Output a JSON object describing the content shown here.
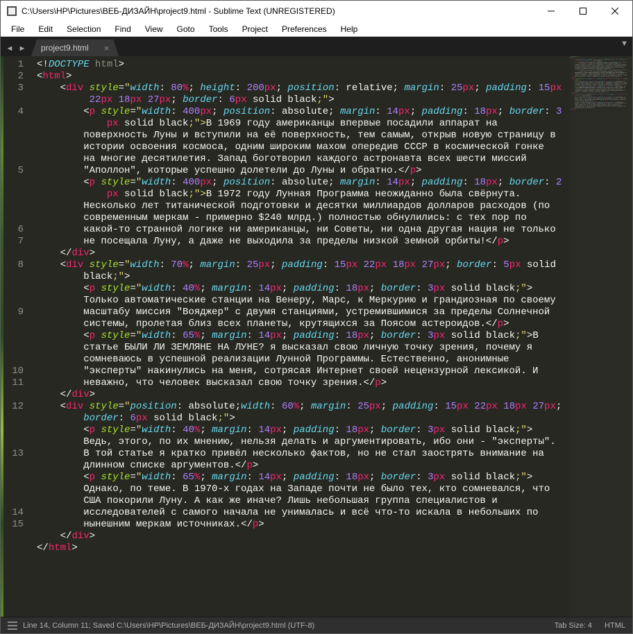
{
  "window": {
    "title": "C:\\Users\\HP\\Pictures\\ВЕБ-ДИЗАЙН\\project9.html - Sublime Text (UNREGISTERED)"
  },
  "menu": {
    "file": "File",
    "edit": "Edit",
    "selection": "Selection",
    "find": "Find",
    "view": "View",
    "goto": "Goto",
    "tools": "Tools",
    "project": "Project",
    "preferences": "Preferences",
    "help": "Help"
  },
  "tab": {
    "name": "project9.html"
  },
  "status": {
    "pos": "Line 14, Column 11; Saved C:\\Users\\HP\\Pictures\\ВЕБ-ДИЗАЙН\\project9.html (UTF-8)",
    "tabsize": "Tab Size: 4",
    "syntax": "HTML"
  },
  "gutter": [
    "1",
    "2",
    "3",
    "",
    "4",
    "",
    "",
    "",
    "",
    "5",
    "",
    "",
    "",
    "",
    "6",
    "7",
    "",
    "8",
    "",
    "",
    "",
    "9",
    "",
    "",
    "",
    "",
    "10",
    "11",
    "",
    "12",
    "",
    "",
    "",
    "13",
    "",
    "",
    "",
    "",
    "14",
    "15"
  ],
  "code": {
    "l1_a": "<!",
    "l1_b": "DOCTYPE",
    "l1_c": " html",
    "l1_d": ">",
    "l2_a": "<",
    "l2_b": "html",
    "l2_c": ">",
    "l3_ind": "    ",
    "l3_a": "<",
    "l3_b": "div",
    "l3_sp": " ",
    "l3_c": "style",
    "l3_eq": "=",
    "l3_q": "\"",
    "l3_p1": "width",
    "l3_v1": ": ",
    "l3_n1": "80",
    "l3_u1": "%",
    "l3_s": "; ",
    "l3_p2": "height",
    "l3_n2": "200",
    "l3_u2": "px",
    "l3_p3": "position",
    "l3_v3": ": relative; ",
    "l3_p4": "margin",
    "l3_n4": "25",
    "l3_u4": "px",
    "l3_p5": "padding",
    "l3_n5a": "15",
    "l3_u5": "px",
    "l3w_ind": "        ",
    "l3w_n1": "22",
    "l3w_n2": "18",
    "l3w_n3": "27",
    "l3_p6": "border",
    "l3_n6": "6",
    "l3_v6": " solid black",
    "l3_end": ";\">",
    "l4_ind": "        ",
    "l4_a": "<",
    "l4_b": "p",
    "l4_c": "style",
    "l4_q": "\"",
    "l4_p1": "width",
    "l4_n1": "400",
    "l4_u1": "px",
    "l4_p2": "position",
    "l4_v2": ": absolute; ",
    "l4_p3": "margin",
    "l4_n3": "14",
    "l4_p4": "padding",
    "l4_n4": "18",
    "l4_p5": "border",
    "l4_n5": "3",
    "l4w_ind": "            ",
    "l4w_v": " solid black",
    "l4_txt": ";\">В 1969 году американцы впервые посадили аппарат на поверхность Луны и вступили на её поверхность, тем самым, открыв новую страницу в истории освоения космоса, одним широким махом опередив СССР в космической гонке на многие десятилетия. Запад боготворил каждого астронавта всех шести миссий \"Аполлон\", которые успешно долетели до Луны и обратно.",
    "l4_ea": "</",
    "l4_eb": "p",
    "l4_ec": ">",
    "l5_ind": "        ",
    "l5_n5": "2",
    "l5_txt": ";\">В 1972 году Лунная Программа неожиданно была свёрнута. Несколько лет титанической подготовки и десятки миллиардов долларов расходов (по современным меркам - примерно $240 млрд.) полностью обнулились: с тех пор по какой-то странной логике ни американцы, ни Советы, ни одна другая нация не только не посещала Луну, а даже не выходила за пределы низкой земной орбиты!",
    "l6_ind": "    ",
    "l6_a": "</",
    "l6_b": "div",
    "l6_c": ">",
    "l7_ind": "    ",
    "l7_n1": "70",
    "l7_n4": "25",
    "l7_n5a": "15",
    "l7_n5b": "22",
    "l7_n5c": "18",
    "l7_n5d": "27",
    "l7_n6": "5",
    "l7w_v": "black",
    "l7_end": ";\">",
    "l8_ind": "        ",
    "l8_n1": "40",
    "l8_u1": "%",
    "l8_n3": "14",
    "l8_n4": "18",
    "l8_n5": "3",
    "l8_txt": "Только автоматические станции на Венеру, Марс, к Меркурию и грандиозная по своему масштабу миссия \"Вояджер\" с двумя станциями, устремившимися за пределы Солнечной системы, пролетая близ всех планеты, крутящихся за Поясом астероидов.",
    "l9_n1": "65",
    "l9_txt": "В статье БЫЛИ ЛИ ЗЕМЛЯНЕ НА ЛУНЕ? я высказал свою личную точку зрения, почему я сомневаюсь в успешной реализации Лунной Программы. Естественно, анонимные \"эксперты\" накинулись на меня, сотрясая Интернет своей нецензурной лексикой. И неважно, что человек высказал свою точку зрения.",
    "l11_ind": "    ",
    "l11_pos": "position",
    "l11_posv": ": absolute;",
    "l11_w": "width",
    "l11_n1": "60",
    "l11_n6": "6",
    "l12_txt": "Ведь, этого, по их мнению, нельзя делать и аргументировать, ибо они - \"эксперты\". В той статье я кратко привёл несколько фактов, но не стал заострять внимание на длинном списке аргументов.",
    "l13_txt": "Однако, по теме. В 1970-х годах на Западе почти не было тех, кто сомневался, что США покорили Луну. А как же иначе? Лишь небольшая группа специалистов и исследователей с самого начала не унималась и всё что-то искала в небольших по нынешним меркам источниках.",
    "l15_a": "</",
    "l15_b": "html",
    "l15_c": ">"
  }
}
